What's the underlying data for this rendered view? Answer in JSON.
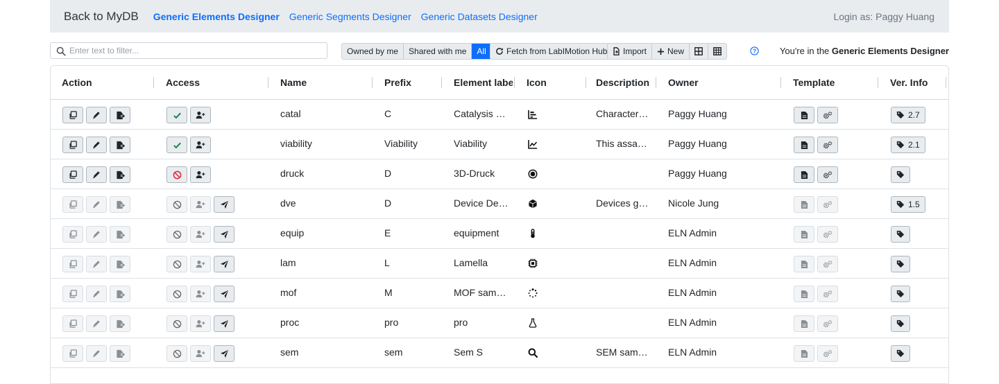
{
  "nav": {
    "brand": "Back to MyDB",
    "links": [
      {
        "label": "Generic Elements Designer",
        "active": true
      },
      {
        "label": "Generic Segments Designer",
        "active": false
      },
      {
        "label": "Generic Datasets Designer",
        "active": false
      }
    ],
    "login": "Login as: Paggy Huang"
  },
  "toolbar": {
    "search_placeholder": "Enter text to filter...",
    "filters": [
      {
        "label": "Owned by me",
        "active": false
      },
      {
        "label": "Shared with me",
        "active": false
      },
      {
        "label": "All",
        "active": true
      }
    ],
    "fetch_label": "Fetch from LabIMotion Hub",
    "import_label": "Import",
    "new_label": "New",
    "you_are_in_prefix": "You're in the",
    "you_are_in_bold": "Generic Elements Designer"
  },
  "colors": {
    "accent": "#0d6efd",
    "success": "#198754",
    "danger": "#dc3545",
    "nav_bg": "#e9ecef"
  },
  "table": {
    "columns": [
      "Action",
      "Access",
      "Name",
      "Prefix",
      "Element label",
      "Icon",
      "Description",
      "Owner",
      "Template",
      "Ver. Info"
    ],
    "rows": [
      {
        "editable": true,
        "access": "check",
        "shareable": false,
        "name": "catal",
        "prefix": "C",
        "label": "Catalysis …",
        "icon": "chart-bar-icon",
        "description": "Character…",
        "owner": "Paggy Huang",
        "version": "2.7"
      },
      {
        "editable": true,
        "access": "check",
        "shareable": false,
        "name": "viability",
        "prefix": "Viability",
        "label": "Viability",
        "icon": "chart-line-icon",
        "description": "This assa…",
        "owner": "Paggy Huang",
        "version": "2.1"
      },
      {
        "editable": true,
        "access": "banned",
        "shareable": false,
        "name": "druck",
        "prefix": "D",
        "label": "3D-Druck",
        "icon": "dot-circle-icon",
        "description": "",
        "owner": "Paggy Huang",
        "version": ""
      },
      {
        "editable": false,
        "access": "none",
        "shareable": true,
        "name": "dve",
        "prefix": "D",
        "label": "Device De…",
        "icon": "cube-icon",
        "description": "Devices g…",
        "owner": "Nicole Jung",
        "version": "1.5"
      },
      {
        "editable": false,
        "access": "none",
        "shareable": true,
        "name": "equip",
        "prefix": "E",
        "label": "equipment",
        "icon": "thermometer-icon",
        "description": "",
        "owner": "ELN Admin",
        "version": ""
      },
      {
        "editable": false,
        "access": "none",
        "shareable": true,
        "name": "lam",
        "prefix": "L",
        "label": "Lamella",
        "icon": "microchip-icon",
        "description": "",
        "owner": "ELN Admin",
        "version": ""
      },
      {
        "editable": false,
        "access": "none",
        "shareable": true,
        "name": "mof",
        "prefix": "M",
        "label": "MOF sam…",
        "icon": "spinner-icon",
        "description": "",
        "owner": "ELN Admin",
        "version": ""
      },
      {
        "editable": false,
        "access": "none",
        "shareable": true,
        "name": "proc",
        "prefix": "pro",
        "label": "pro",
        "icon": "flask-outline-icon",
        "description": "",
        "owner": "ELN Admin",
        "version": ""
      },
      {
        "editable": false,
        "access": "none",
        "shareable": true,
        "name": "sem",
        "prefix": "sem",
        "label": "Sem S",
        "icon": "search-icon",
        "description": "SEM sam…",
        "owner": "ELN Admin",
        "version": ""
      }
    ]
  }
}
